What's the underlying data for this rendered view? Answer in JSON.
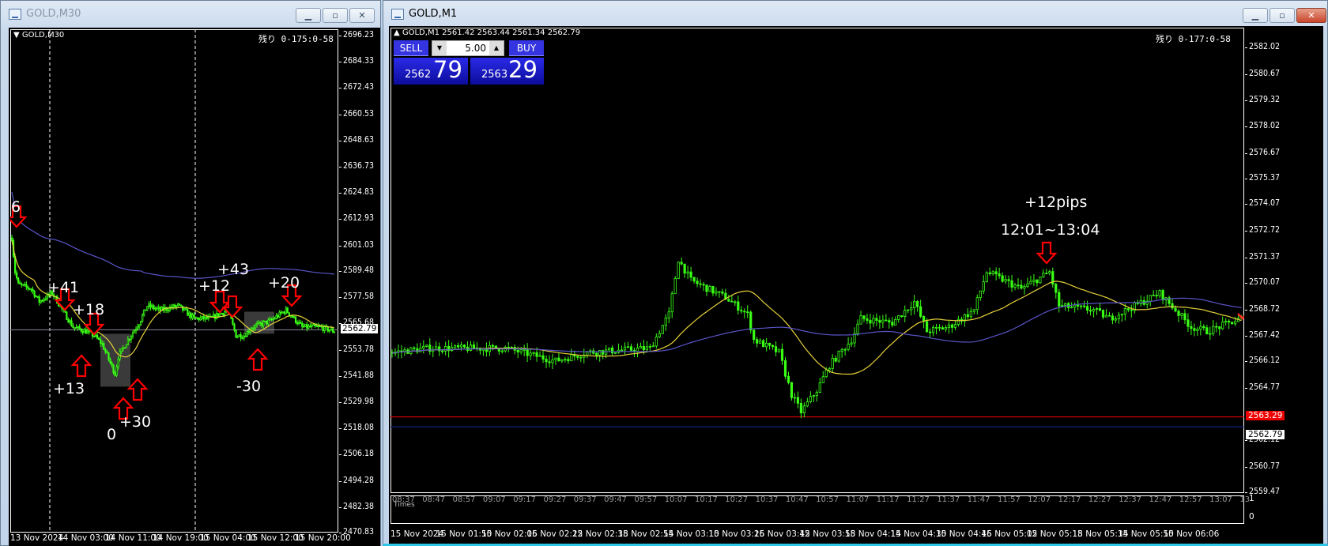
{
  "left_window": {
    "title": "GOLD,M30",
    "chart_label": "GOLD,M30",
    "countdown": "残り 0-175:0-58",
    "price_labels": [
      "2696.23",
      "2684.33",
      "2672.43",
      "2660.53",
      "2648.63",
      "2636.73",
      "2624.83",
      "2612.93",
      "2601.03",
      "2589.48",
      "2577.58",
      "2565.68",
      "2553.78",
      "2541.88",
      "2529.98",
      "2518.08",
      "2506.18",
      "2494.28",
      "2482.38",
      "2470.83"
    ],
    "price_range": [
      2470.83,
      2696.23
    ],
    "current_price": "2562.79",
    "time_labels": [
      "13 Nov 2024",
      "14 Nov 03:00",
      "14 Nov 11:00",
      "14 Nov 19:00",
      "15 Nov 04:00",
      "15 Nov 12:00",
      "15 Nov 20:00"
    ],
    "annotations": [
      "6",
      "+41",
      "+18",
      "+13",
      "0",
      "+30",
      "+12",
      "+43",
      "+20",
      "-30"
    ],
    "price_path": [
      [
        0,
        2604.5
      ],
      [
        2,
        2589.1
      ],
      [
        4,
        2583.3
      ],
      [
        12,
        2581.4
      ],
      [
        17,
        2575.6
      ],
      [
        25,
        2579.5
      ],
      [
        33,
        2569.8
      ],
      [
        38,
        2564.0
      ],
      [
        46,
        2562.1
      ],
      [
        51,
        2560.2
      ],
      [
        56,
        2556.3
      ],
      [
        64,
        2542.8
      ],
      [
        66,
        2550.6
      ],
      [
        72,
        2558.3
      ],
      [
        79,
        2566.0
      ],
      [
        84,
        2573.7
      ],
      [
        92,
        2571.7
      ],
      [
        103,
        2573.7
      ],
      [
        113,
        2567.9
      ],
      [
        123,
        2567.9
      ],
      [
        134,
        2571.7
      ],
      [
        139,
        2560.2
      ],
      [
        144,
        2560.2
      ],
      [
        149,
        2564.0
      ],
      [
        160,
        2566.7
      ],
      [
        170,
        2571.7
      ],
      [
        180,
        2564.0
      ],
      [
        191,
        2564.0
      ],
      [
        200,
        2562.1
      ]
    ]
  },
  "right_window": {
    "title": "GOLD,M1",
    "chart_label": "GOLD,M1",
    "ohlc": "2561.42 2563.44 2561.34 2562.79",
    "countdown": "残り 0-177:0-58",
    "trade_panel": {
      "sell_label": "SELL",
      "buy_label": "BUY",
      "lot": "5.00",
      "sell_price_prefix": "2562",
      "sell_price_big": "79",
      "buy_price_prefix": "2563",
      "buy_price_big": "29"
    },
    "price_labels": [
      "2582.02",
      "2580.67",
      "2579.32",
      "2578.02",
      "2576.67",
      "2575.37",
      "2574.07",
      "2572.72",
      "2571.37",
      "2570.07",
      "2568.72",
      "2567.42",
      "2566.12",
      "2564.77",
      "2562.12",
      "2560.77",
      "2559.47"
    ],
    "price_range": [
      2559.47,
      2582.02
    ],
    "ask_price": "2563.29",
    "bid_price": "2562.79",
    "annotation_pips": "+12pips",
    "annotation_time": "12:01~13:04",
    "indicator": {
      "name": "Times",
      "labels": [
        "08:37",
        "08:47",
        "08:57",
        "09:07",
        "09:17",
        "09:27",
        "09:37",
        "09:47",
        "09:57",
        "10:07",
        "10:17",
        "10:27",
        "10:37",
        "10:47",
        "10:57",
        "11:07",
        "11:17",
        "11:27",
        "11:37",
        "11:47",
        "11:57",
        "12:07",
        "12:17",
        "12:27",
        "12:37",
        "12:47",
        "12:57",
        "13:07",
        "13"
      ],
      "scale_top": "1",
      "scale_bottom": "0"
    },
    "time_labels": [
      "15 Nov 2024",
      "15 Nov 01:50",
      "15 Nov 02:06",
      "15 Nov 02:22",
      "15 Nov 02:38",
      "15 Nov 02:54",
      "15 Nov 03:10",
      "15 Nov 03:26",
      "15 Nov 03:42",
      "15 Nov 03:58",
      "15 Nov 04:14",
      "15 Nov 04:30",
      "15 Nov 04:46",
      "15 Nov 05:02",
      "15 Nov 05:18",
      "15 Nov 05:34",
      "15 Nov 05:50",
      "15 Nov 06:06"
    ],
    "price_path": [
      [
        0,
        2566.56
      ],
      [
        11,
        2566.77
      ],
      [
        36,
        2566.77
      ],
      [
        52,
        2566.13
      ],
      [
        62,
        2566.56
      ],
      [
        82,
        2566.77
      ],
      [
        88,
        2568.49
      ],
      [
        91,
        2571.28
      ],
      [
        95,
        2570.21
      ],
      [
        106,
        2569.35
      ],
      [
        113,
        2568.49
      ],
      [
        115,
        2567.2
      ],
      [
        123,
        2566.56
      ],
      [
        127,
        2564.41
      ],
      [
        130,
        2563.55
      ],
      [
        135,
        2564.63
      ],
      [
        139,
        2565.91
      ],
      [
        146,
        2567.2
      ],
      [
        149,
        2568.28
      ],
      [
        159,
        2568.06
      ],
      [
        166,
        2569.13
      ],
      [
        170,
        2567.63
      ],
      [
        177,
        2567.85
      ],
      [
        185,
        2568.71
      ],
      [
        189,
        2570.64
      ],
      [
        200,
        2569.78
      ],
      [
        209,
        2570.64
      ],
      [
        212,
        2568.92
      ],
      [
        223,
        2568.71
      ],
      [
        228,
        2568.28
      ],
      [
        244,
        2569.56
      ],
      [
        254,
        2567.85
      ],
      [
        259,
        2567.63
      ],
      [
        270,
        2568.28
      ]
    ]
  },
  "colors": {
    "bull": "#39ff14",
    "bear": "#39ff14",
    "ma_fast": "#e6d23a",
    "ma_slow": "#5a55c8",
    "ask_line": "#ff0000",
    "bid_line": "#1c2aa0",
    "arrow": "#ff0000",
    "panel_blue": "#1a1ad0"
  }
}
